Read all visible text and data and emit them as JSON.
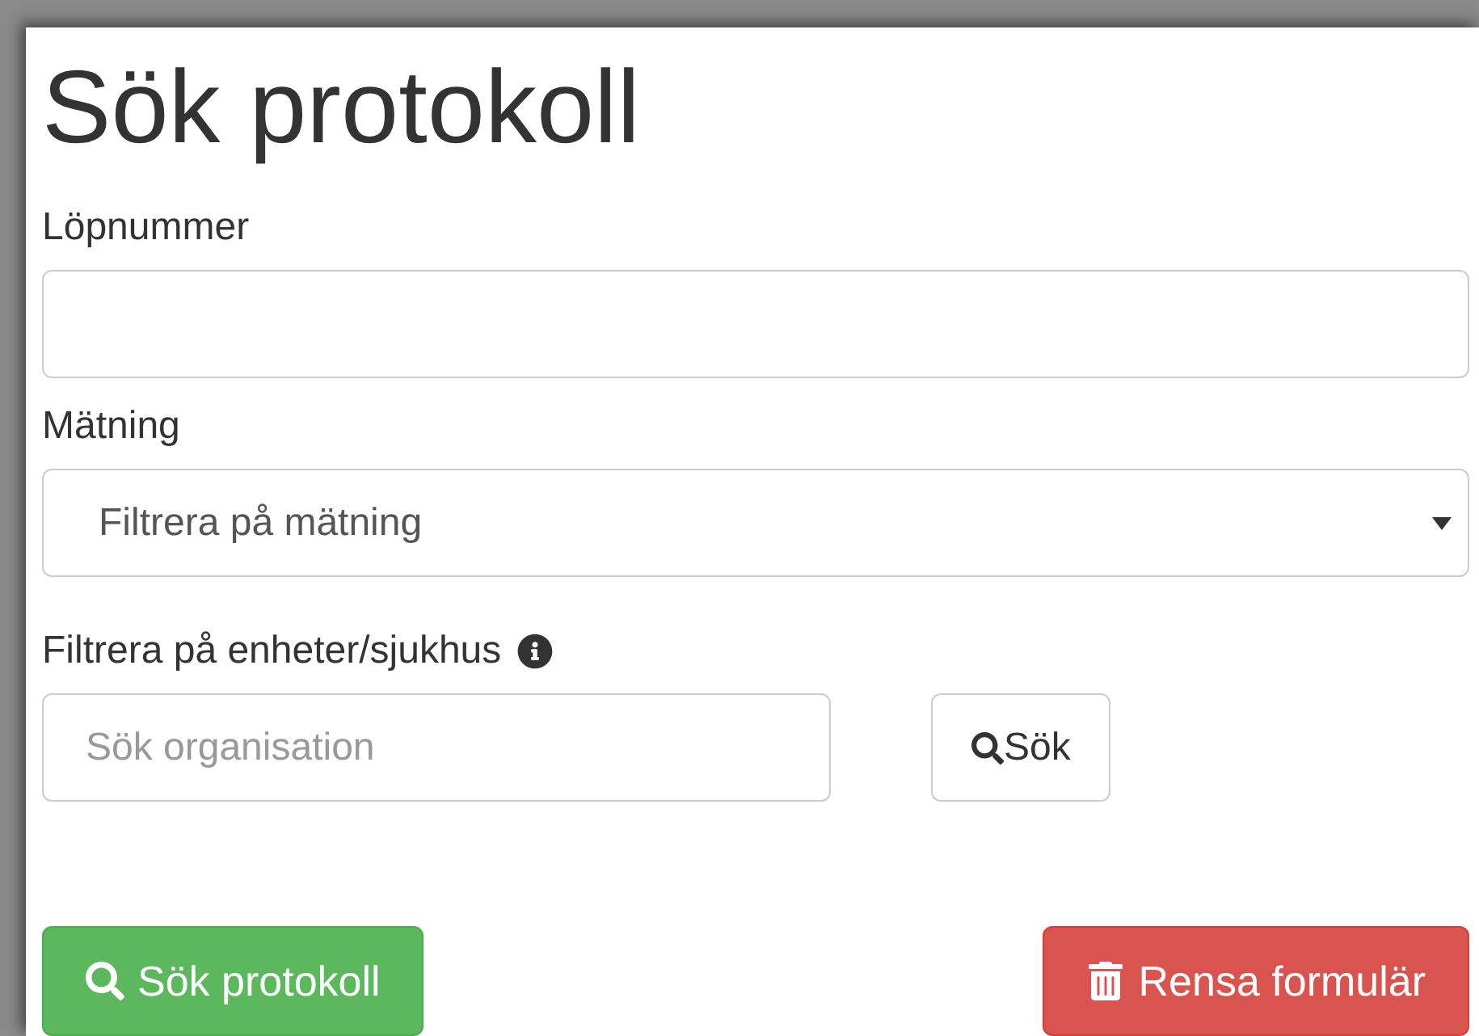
{
  "title": "Sök protokoll",
  "fields": [
    {
      "kind": "text",
      "label": "Löpnummer"
    },
    {
      "kind": "select",
      "label": "Mätning",
      "value": "Filtrera på mätning"
    }
  ],
  "org_filter": {
    "label": "Filtrera på enheter/sjukhus",
    "placeholder": "Sök organisation",
    "search_button": "Sök"
  },
  "actions": [
    {
      "kind": "primary",
      "label": "Sök protokoll"
    },
    {
      "kind": "danger",
      "label": "Rensa formulär"
    }
  ]
}
